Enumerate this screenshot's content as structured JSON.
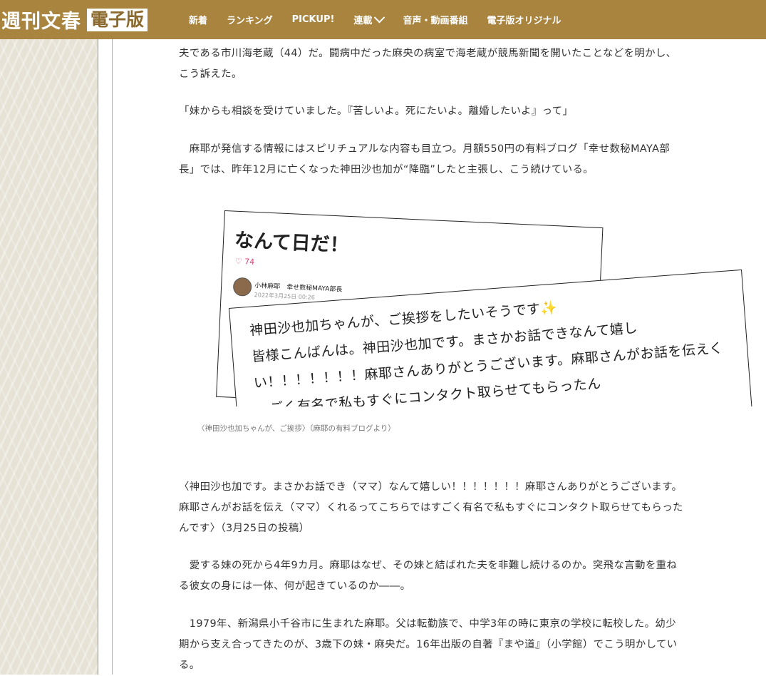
{
  "header": {
    "logo_main": "週刊文春",
    "logo_box": "電子版",
    "nav": [
      "新着",
      "ランキング",
      "PICKUP!",
      "連載",
      "音声・動画番組",
      "電子版オリジナル"
    ]
  },
  "article": {
    "p1": "夫である市川海老蔵（44）だ。闘病中だった麻央の病室で海老蔵が競馬新聞を開いたことなどを明かし、こう訴えた。",
    "p2": "「妹からも相談を受けていました。『苦しいよ。死にたいよ。離婚したいよ』って」",
    "p3": "　麻耶が発信する情報にはスピリチュアルな内容も目立つ。月額550円の有料ブログ「幸せ数秘MAYA部長」では、昨年12月に亡くなった神田沙也加が“降臨”したと主張し、こう続けている。",
    "caption": "〈神田沙也加ちゃんが、ご挨拶〉（麻耶の有料ブログより）",
    "p4": "〈神田沙也加です。まさかお話でき（ママ）なんて嬉しい！！！！！！！麻耶さんありがとうございます。麻耶さんがお話を伝え（ママ）くれるってこちらではすごく有名で私もすぐにコンタクト取らせてもらったんです〉（3月25日の投稿）",
    "p5": "　愛する妹の死から4年9カ月。麻耶はなぜ、その妹と結ばれた夫を非難し続けるのか。突飛な言動を重ねる彼女の身には一体、何が起きているのか――。",
    "p6": "　1979年、新潟県小千谷市に生まれた麻耶。父は転勤族で、中学3年の時に東京の学校に転校した。幼少期から支え合ってきたのが、3歳下の妹・麻央だ。16年出版の自著『まや道』（小学館）でこう明かしている。"
  },
  "figure": {
    "title": "なんて日だ！",
    "likes": "♡ 74",
    "author": "小林麻耶　幸せ数秘MAYA部長",
    "date": "2022年3月25日 00:26",
    "lines": [
      "神田沙也加ちゃんが、ご挨拶をしたいそうです",
      "皆様こんばんは。神田沙也加です。まさかお話できなんて嬉し",
      "い！！！！！！！麻耶さんありがとうございます。麻耶さんがお話を伝えく",
      "…ごく有名で私もすぐにコンタクト取らせてもらったん"
    ],
    "sparkle": "✨"
  }
}
